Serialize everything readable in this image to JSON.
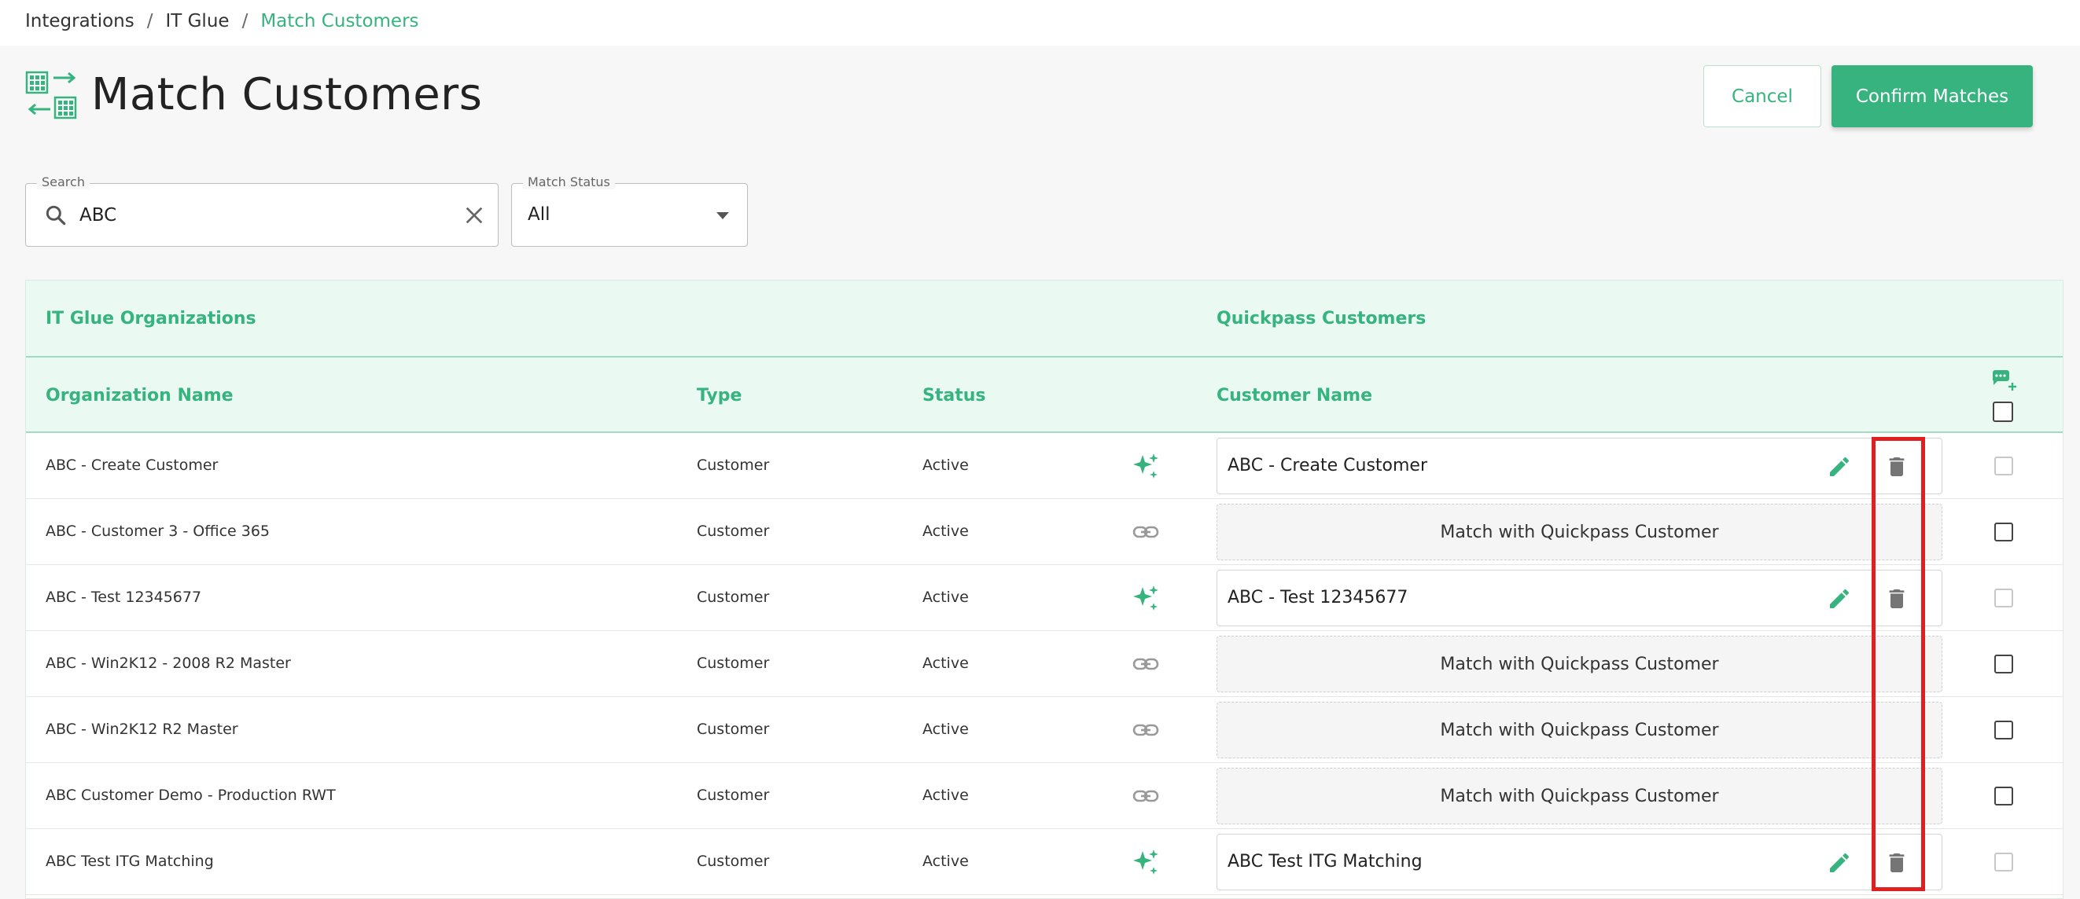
{
  "breadcrumb": {
    "items": [
      "Integrations",
      "IT Glue"
    ],
    "current": "Match Customers",
    "separator": "/"
  },
  "page": {
    "title": "Match Customers",
    "icon": "match-customers-icon"
  },
  "actions": {
    "cancel_label": "Cancel",
    "confirm_label": "Confirm Matches"
  },
  "filters": {
    "search_label": "Search",
    "search_value": "ABC",
    "status_label": "Match Status",
    "status_value": "All"
  },
  "table": {
    "group_left": "IT Glue Organizations",
    "group_right": "Quickpass Customers",
    "columns": {
      "org_name": "Organization Name",
      "type": "Type",
      "status": "Status",
      "customer_name": "Customer Name"
    },
    "match_placeholder": "Match with Quickpass Customer",
    "rows": [
      {
        "org": "ABC - Create Customer",
        "type": "Customer",
        "status": "Active",
        "icon": "auto-match-sparkle-icon",
        "matched": true,
        "customer": "ABC - Create Customer"
      },
      {
        "org": "ABC - Customer 3 - Office 365",
        "type": "Customer",
        "status": "Active",
        "icon": "link-icon",
        "matched": false,
        "customer": ""
      },
      {
        "org": "ABC - Test 12345677",
        "type": "Customer",
        "status": "Active",
        "icon": "auto-match-sparkle-icon",
        "matched": true,
        "customer": "ABC - Test 12345677"
      },
      {
        "org": "ABC - Win2K12 - 2008 R2 Master",
        "type": "Customer",
        "status": "Active",
        "icon": "link-icon",
        "matched": false,
        "customer": ""
      },
      {
        "org": "ABC - Win2K12 R2 Master",
        "type": "Customer",
        "status": "Active",
        "icon": "link-icon",
        "matched": false,
        "customer": ""
      },
      {
        "org": "ABC Customer Demo - Production RWT",
        "type": "Customer",
        "status": "Active",
        "icon": "link-icon",
        "matched": false,
        "customer": ""
      },
      {
        "org": "ABC Test ITG Matching",
        "type": "Customer",
        "status": "Active",
        "icon": "auto-match-sparkle-icon",
        "matched": true,
        "customer": "ABC Test ITG Matching"
      }
    ]
  },
  "colors": {
    "accent": "#36b37e",
    "header_bg": "#eafaf3",
    "highlight": "#e02020"
  }
}
